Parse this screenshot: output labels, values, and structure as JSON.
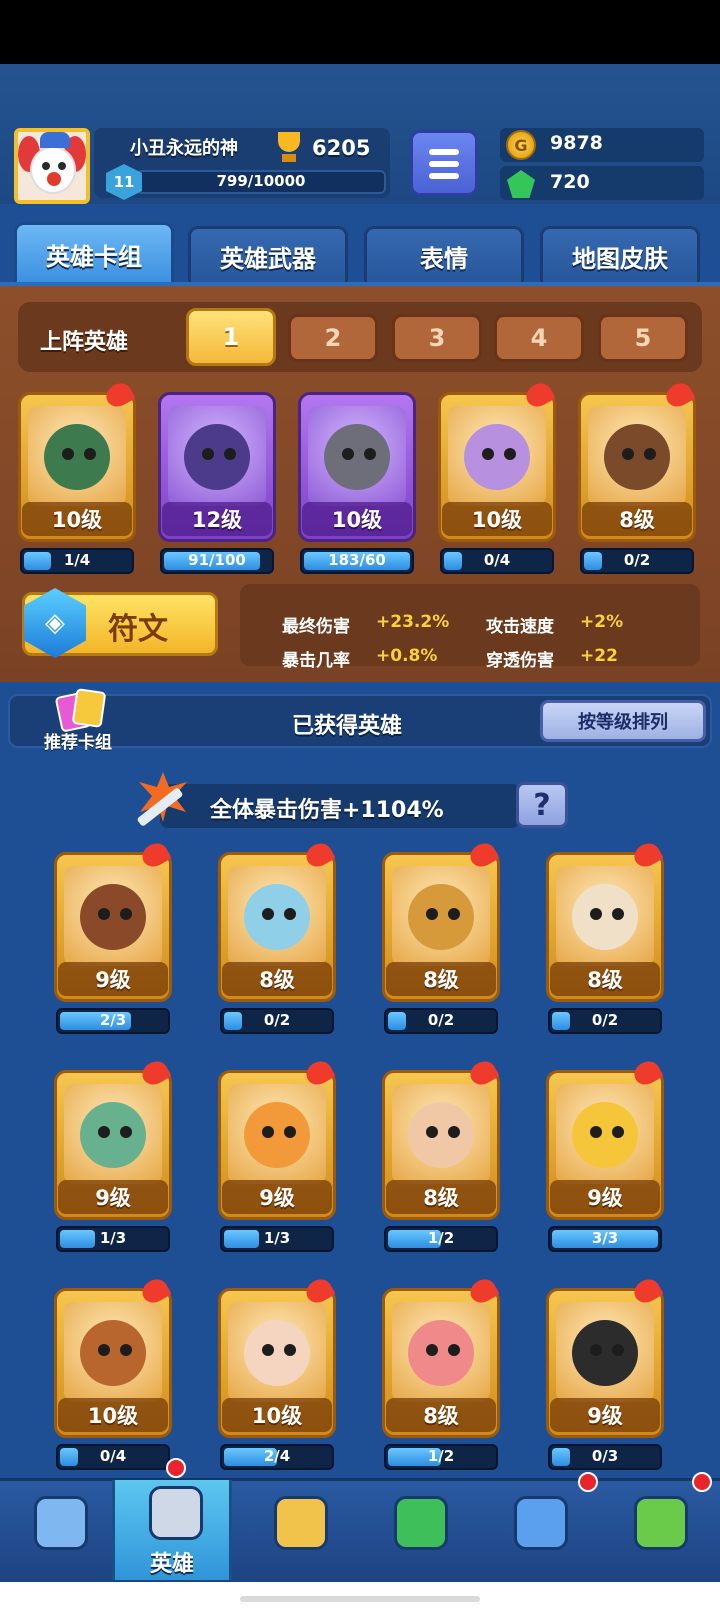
{
  "player": {
    "name": "小丑永远的神",
    "trophies": "6205",
    "level": "11",
    "xp": "799/10000"
  },
  "currency": {
    "gold": "9878",
    "gems": "720",
    "coin_symbol": "G"
  },
  "tabs": [
    {
      "label": "英雄卡组"
    },
    {
      "label": "英雄武器"
    },
    {
      "label": "表情"
    },
    {
      "label": "地图皮肤"
    }
  ],
  "lineup": {
    "label": "上阵英雄",
    "slots": [
      "1",
      "2",
      "3",
      "4",
      "5"
    ],
    "active_slot": "1",
    "heroes": [
      {
        "level": "10级",
        "progress": "1/4",
        "fill": 0.25,
        "rarity": "gold"
      },
      {
        "level": "12级",
        "progress": "91/100",
        "fill": 0.91,
        "rarity": "purple"
      },
      {
        "level": "10级",
        "progress": "183/60",
        "fill": 1.0,
        "rarity": "purple"
      },
      {
        "level": "10级",
        "progress": "0/4",
        "fill": 0.0,
        "rarity": "gold"
      },
      {
        "level": "8级",
        "progress": "0/2",
        "fill": 0.0,
        "rarity": "gold"
      }
    ]
  },
  "rune": {
    "label": "符文",
    "stats": [
      {
        "name": "最终伤害",
        "value": "+23.2%"
      },
      {
        "name": "攻击速度",
        "value": "+2%"
      },
      {
        "name": "暴击几率",
        "value": "+0.8%"
      },
      {
        "name": "穿透伤害",
        "value": "+22"
      }
    ]
  },
  "owned": {
    "deck_label": "推荐卡组",
    "title": "已获得英雄",
    "sort_label": "按等级排列",
    "bonus_text": "全体暴击伤害+1104%",
    "help": "?",
    "heroes": [
      {
        "level": "9级",
        "progress": "2/3",
        "fill": 0.67
      },
      {
        "level": "8级",
        "progress": "0/2",
        "fill": 0.0
      },
      {
        "level": "8级",
        "progress": "0/2",
        "fill": 0.0
      },
      {
        "level": "8级",
        "progress": "0/2",
        "fill": 0.0
      },
      {
        "level": "9级",
        "progress": "1/3",
        "fill": 0.33
      },
      {
        "level": "9级",
        "progress": "1/3",
        "fill": 0.33
      },
      {
        "level": "8级",
        "progress": "1/2",
        "fill": 0.5
      },
      {
        "level": "9级",
        "progress": "3/3",
        "fill": 1.0
      },
      {
        "level": "10级",
        "progress": "0/4",
        "fill": 0.0
      },
      {
        "level": "10级",
        "progress": "2/4",
        "fill": 0.5
      },
      {
        "level": "8级",
        "progress": "1/2",
        "fill": 0.5
      },
      {
        "level": "9级",
        "progress": "0/3",
        "fill": 0.0
      }
    ]
  },
  "nav": {
    "items": [
      {
        "icon": "chest-icon",
        "label": ""
      },
      {
        "icon": "knight-helmet-icon",
        "label": "英雄"
      },
      {
        "icon": "crossed-swords-icon",
        "label": ""
      },
      {
        "icon": "crown-shield-icon",
        "label": ""
      },
      {
        "icon": "social-icon",
        "label": ""
      },
      {
        "icon": "sprout-island-icon",
        "label": ""
      }
    ],
    "active_label": "英雄"
  },
  "colors": {
    "background": "#1e4f94",
    "wood": "#8d4f2b",
    "gold_frame": "#f6c64e",
    "purple_frame": "#b277f0",
    "stat_value": "#f7d23a"
  }
}
